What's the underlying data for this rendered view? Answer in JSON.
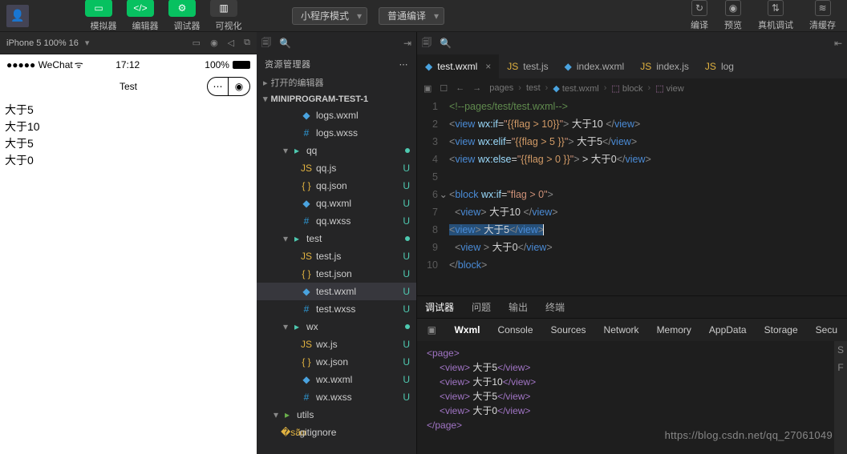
{
  "toolbar": {
    "btns": [
      {
        "name": "simulator-button",
        "label": "模拟器",
        "style": "g",
        "icon": "phone"
      },
      {
        "name": "editor-button",
        "label": "编辑器",
        "style": "g",
        "icon": "code"
      },
      {
        "name": "debugger-button",
        "label": "调试器",
        "style": "g",
        "icon": "bug"
      },
      {
        "name": "visualize-button",
        "label": "可视化",
        "style": "d",
        "icon": "layout"
      }
    ],
    "mode_select": "小程序模式",
    "compile_select": "普通编译",
    "right": [
      {
        "name": "compile-button",
        "label": "编译",
        "icon": "↻"
      },
      {
        "name": "preview-button",
        "label": "预览",
        "icon": "◉"
      },
      {
        "name": "remote-debug-button",
        "label": "真机调试",
        "icon": "⇅"
      },
      {
        "name": "clear-cache-button",
        "label": "清缓存",
        "icon": "≋"
      }
    ]
  },
  "simulator": {
    "device": "iPhone 5 100% 16",
    "status": {
      "left": "●●●●● WeChat",
      "wifi": "📶",
      "time": "17:12",
      "battery_pct": "100%"
    },
    "navbar_title": "Test",
    "page_lines": [
      "大于5",
      "大于10",
      "大于5",
      "大于0"
    ]
  },
  "explorer": {
    "header": "资源管理器",
    "open_editors": "打开的编辑器",
    "project": "MINIPROGRAM-TEST-1",
    "tree": [
      {
        "depth": 3,
        "kind": "wxml",
        "label": "logs.wxml",
        "name": "file-logs-wxml"
      },
      {
        "depth": 3,
        "kind": "wxss",
        "label": "logs.wxss",
        "name": "file-logs-wxss"
      },
      {
        "depth": 2,
        "kind": "folder",
        "label": "qq",
        "mod": "dot",
        "name": "folder-qq"
      },
      {
        "depth": 3,
        "kind": "js",
        "label": "qq.js",
        "status": "U",
        "name": "file-qq-js"
      },
      {
        "depth": 3,
        "kind": "json",
        "label": "qq.json",
        "status": "U",
        "name": "file-qq-json"
      },
      {
        "depth": 3,
        "kind": "wxml",
        "label": "qq.wxml",
        "status": "U",
        "name": "file-qq-wxml"
      },
      {
        "depth": 3,
        "kind": "wxss",
        "label": "qq.wxss",
        "status": "U",
        "name": "file-qq-wxss"
      },
      {
        "depth": 2,
        "kind": "folder",
        "label": "test",
        "mod": "dot",
        "name": "folder-test"
      },
      {
        "depth": 3,
        "kind": "js",
        "label": "test.js",
        "status": "U",
        "name": "file-test-js"
      },
      {
        "depth": 3,
        "kind": "json",
        "label": "test.json",
        "status": "U",
        "name": "file-test-json"
      },
      {
        "depth": 3,
        "kind": "wxml",
        "label": "test.wxml",
        "status": "U",
        "sel": true,
        "name": "file-test-wxml"
      },
      {
        "depth": 3,
        "kind": "wxss",
        "label": "test.wxss",
        "status": "U",
        "name": "file-test-wxss"
      },
      {
        "depth": 2,
        "kind": "folder",
        "label": "wx",
        "mod": "dot",
        "name": "folder-wx"
      },
      {
        "depth": 3,
        "kind": "js",
        "label": "wx.js",
        "status": "U",
        "name": "file-wx-js"
      },
      {
        "depth": 3,
        "kind": "json",
        "label": "wx.json",
        "status": "U",
        "name": "file-wx-json"
      },
      {
        "depth": 3,
        "kind": "wxml",
        "label": "wx.wxml",
        "status": "U",
        "name": "file-wx-wxml"
      },
      {
        "depth": 3,
        "kind": "wxss",
        "label": "wx.wxss",
        "status": "U",
        "name": "file-wx-wxss"
      },
      {
        "depth": 1,
        "kind": "utils",
        "label": "utils",
        "name": "folder-utils"
      },
      {
        "depth": 1,
        "kind": "git",
        "label": ".gitignore",
        "name": "file-gitignore"
      }
    ]
  },
  "editor": {
    "tabs": [
      {
        "icon": "wxml",
        "label": "test.wxml",
        "active": true,
        "close": true,
        "name": "tab-test-wxml"
      },
      {
        "icon": "js",
        "label": "test.js",
        "name": "tab-test-js"
      },
      {
        "icon": "wxml",
        "label": "index.wxml",
        "name": "tab-index-wxml"
      },
      {
        "icon": "js",
        "label": "index.js",
        "name": "tab-index-js"
      },
      {
        "icon": "js",
        "label": "log",
        "name": "tab-log"
      }
    ],
    "breadcrumb": [
      "pages",
      "test",
      "test.wxml",
      "block",
      "view"
    ],
    "lines": [
      {
        "n": 1,
        "html": "<span class='c-cmt'>&lt;!--pages/test/test.wxml--&gt;</span>"
      },
      {
        "n": 2,
        "html": "<span class='c-br'>&lt;</span><span class='c-tag'>view</span> <span class='c-attr'>wx:if</span>=<span class='c-str'>\"</span><span class='c-cur'>{{flag &gt; 10}}</span><span class='c-str'>\"</span><span class='c-br'>&gt;</span> <span class='c-txt'>大于10</span> <span class='c-br'>&lt;/</span><span class='c-tag'>view</span><span class='c-br'>&gt;</span>"
      },
      {
        "n": 3,
        "html": "<span class='c-br'>&lt;</span><span class='c-tag'>view</span> <span class='c-attr'>wx:elif</span>=<span class='c-str'>\"</span><span class='c-cur'>{{flag &gt; 5 }}</span><span class='c-str'>\"</span><span class='c-br'>&gt;</span> <span class='c-txt'>大于5</span><span class='c-br'>&lt;/</span><span class='c-tag'>view</span><span class='c-br'>&gt;</span>"
      },
      {
        "n": 4,
        "html": "<span class='c-br'>&lt;</span><span class='c-tag'>view</span> <span class='c-attr'>wx:else</span>=<span class='c-str'>\"</span><span class='c-cur'>{{flag &gt; 0 }}</span><span class='c-str'>\"</span><span class='c-br'>&gt;</span> <span class='c-txt'>&gt; 大于0</span><span class='c-br'>&lt;/</span><span class='c-tag'>view</span><span class='c-br'>&gt;</span>"
      },
      {
        "n": 5,
        "html": ""
      },
      {
        "n": 6,
        "fold": true,
        "html": "<span class='c-br'>&lt;</span><span class='c-tag'>block</span> <span class='c-attr'>wx:if</span>=<span class='c-str'>\"flag &gt; 0\"</span><span class='c-br'>&gt;</span>"
      },
      {
        "n": 7,
        "indent": 1,
        "html": "<span class='c-br'>&lt;</span><span class='c-tag'>view</span><span class='c-br'>&gt;</span> <span class='c-txt'>大于10</span> <span class='c-br'>&lt;/</span><span class='c-tag'>view</span><span class='c-br'>&gt;</span>"
      },
      {
        "n": 8,
        "indent": 0,
        "sel": true,
        "html": "<span class='c-br'>&lt;</span><span class='c-tag'>view</span><span class='c-br'>&gt;</span> <span class='c-txt'>大于5</span><span class='c-br'>&lt;/</span><span class='c-tag'>view</span><span class='c-br'>&gt;</span><span class='caret'></span>"
      },
      {
        "n": 9,
        "indent": 1,
        "html": "<span class='c-br'>&lt;</span><span class='c-tag'>view</span> <span class='c-br'>&gt;</span> <span class='c-txt'>大于0</span><span class='c-br'>&lt;/</span><span class='c-tag'>view</span><span class='c-br'>&gt;</span>"
      },
      {
        "n": 10,
        "html": "<span class='c-br'>&lt;/</span><span class='c-tag'>block</span><span class='c-br'>&gt;</span>"
      }
    ]
  },
  "panel": {
    "tabs": [
      "调试器",
      "问题",
      "输出",
      "终端"
    ],
    "active_tab": "调试器",
    "sub": [
      "Wxml",
      "Console",
      "Sources",
      "Network",
      "Memory",
      "AppData",
      "Storage",
      "Secu"
    ],
    "active_sub": "Wxml",
    "wxml": [
      {
        "d": 0,
        "t": "<page>"
      },
      {
        "d": 1,
        "t": "<view> 大于5</view>"
      },
      {
        "d": 1,
        "t": "<view> 大于10</view>"
      },
      {
        "d": 1,
        "t": "<view> 大于5</view>"
      },
      {
        "d": 1,
        "t": "<view> 大于0</view>"
      },
      {
        "d": 0,
        "t": "</page>"
      }
    ],
    "side_labels": [
      "S",
      "F"
    ]
  },
  "watermark": "https://blog.csdn.net/qq_27061049"
}
